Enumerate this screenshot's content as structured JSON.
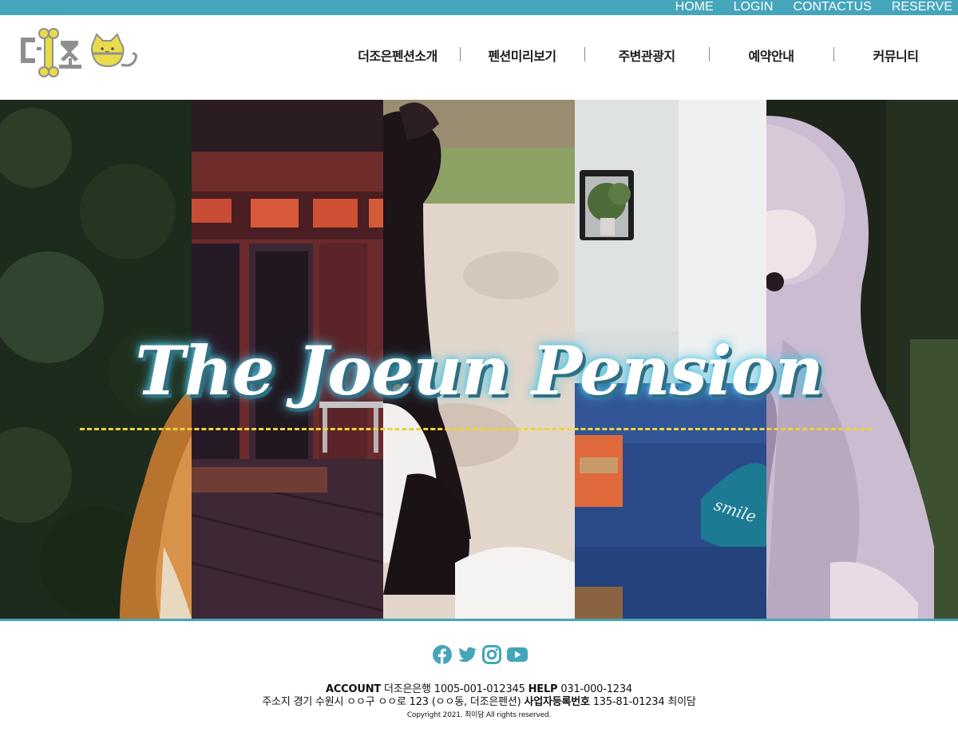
{
  "topbar": {
    "links": [
      "HOME",
      "LOGIN",
      "CONTACTUS",
      "RESERVE"
    ]
  },
  "header": {
    "logo_text": "더조",
    "nav": [
      "더조은펜션소개",
      "펜션미리보기",
      "주변관광지",
      "예약안내",
      "커뮤니티"
    ]
  },
  "hero": {
    "title": "The Joeun Pension"
  },
  "footer": {
    "sns_icons": [
      "facebook-icon",
      "twitter-icon",
      "instagram-icon",
      "youtube-icon"
    ],
    "account_label": "ACCOUNT",
    "account_value": "더조은은행 1005-001-012345",
    "help_label": "HELP",
    "help_value": "031-000-1234",
    "address_label": "주소지",
    "address_value": "경기 수원시 ㅇㅇ구 ㅇㅇ로 123 (ㅇㅇ동, 더조은펜션)",
    "bizno_label": "사업자등록번호",
    "bizno_value": "135-81-01234 최이담",
    "copyright": "Copyright 2021. 최이담 All rights reserved."
  },
  "colors": {
    "accent": "#44a5bb",
    "dashed_line": "#f0d23a",
    "logo_yellow": "#e8dc4a",
    "logo_gray": "#8f8f8f"
  }
}
